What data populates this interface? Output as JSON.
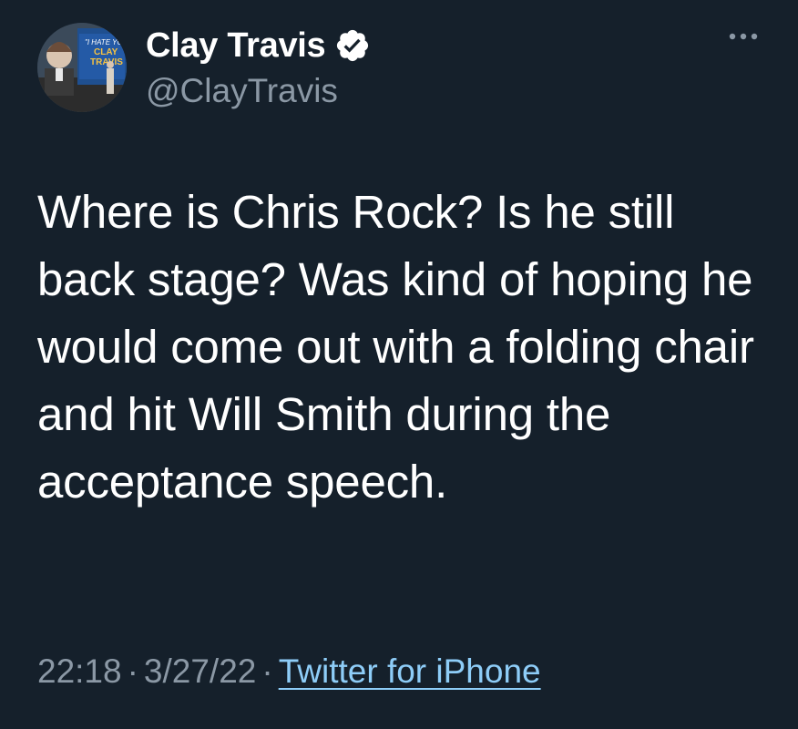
{
  "author": {
    "display_name": "Clay Travis",
    "handle": "@ClayTravis",
    "verified": true,
    "avatar_icon": "profile-photo",
    "avatar_sign_text": "\"I HATE YOU CLAY TRAVIS\""
  },
  "tweet": {
    "text": "Where is Chris Rock? Is he still back stage? Was kind of hoping he would come out with a folding chair and hit Will Smith during the acceptance speech."
  },
  "meta": {
    "time": "22:18",
    "separator": "·",
    "date": "3/27/22",
    "source": "Twitter for iPhone"
  },
  "menu": {
    "icon": "more-icon"
  },
  "colors": {
    "background": "#15202b",
    "text_primary": "#ffffff",
    "text_secondary": "#8b98a5",
    "link": "#8ecdf8"
  }
}
